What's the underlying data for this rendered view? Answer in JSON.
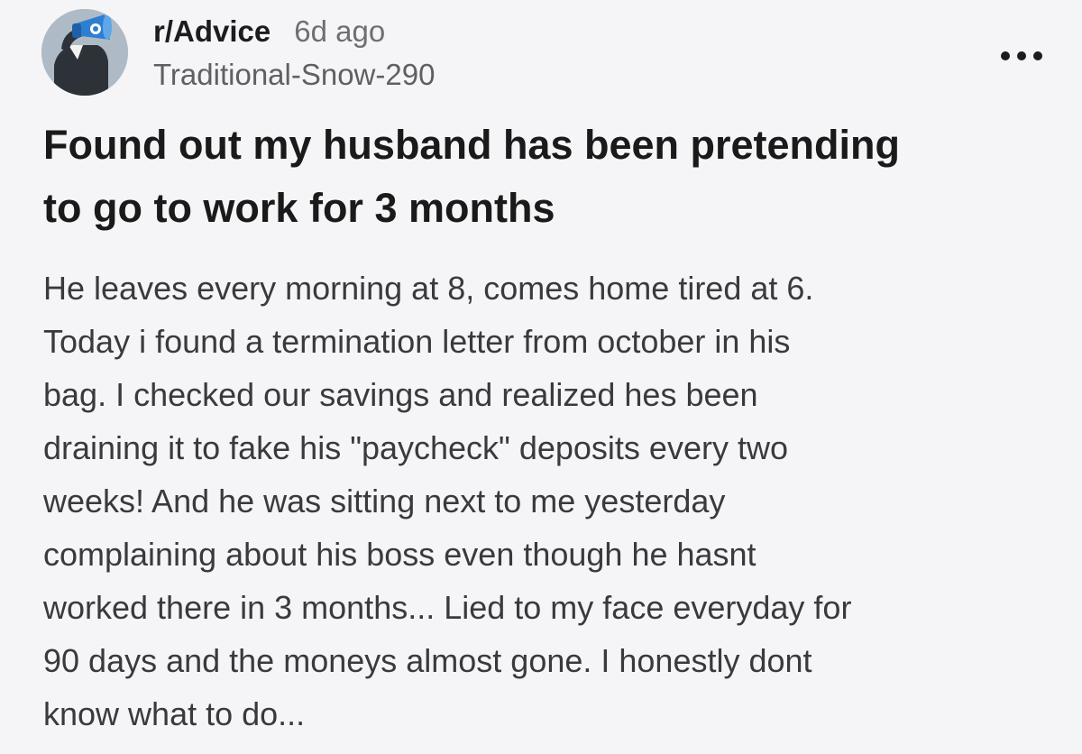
{
  "post": {
    "subreddit": "r/Advice",
    "age": "6d ago",
    "username": "Traditional-Snow-290",
    "more_icon": "ellipsis-icon",
    "avatar_icon": "snoo-avatar-icon",
    "title_lines": [
      "Found out my husband has been pretending",
      "to go to work for 3 months"
    ],
    "body_lines": [
      "He leaves every morning at 8, comes home tired at 6.",
      "Today i found a termination letter from october in his",
      "bag. I checked our savings and realized hes been",
      "draining it to fake his \"paycheck\" deposits every two",
      "weeks! And he was sitting next to me yesterday",
      "complaining about his boss even though he hasnt",
      "worked there in 3 months... Lied to my face everyday for",
      "90 days and the moneys almost gone. I honestly dont",
      "know what to do..."
    ]
  },
  "colors": {
    "background": "#f5f5f7",
    "avatar_background": "#aebbc6",
    "accent_blue": "#2f7fd0"
  }
}
